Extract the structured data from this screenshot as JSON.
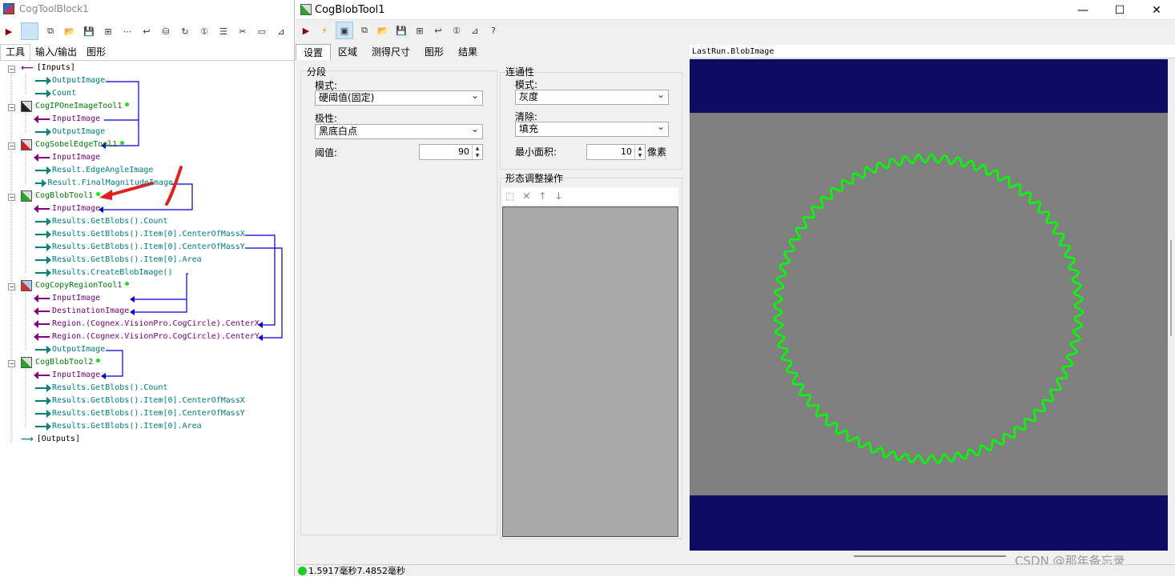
{
  "left_window": {
    "title": "CogToolBlock1",
    "tabs": [
      "工具",
      "输入/输出",
      "图形"
    ],
    "tree": [
      {
        "text": "[Inputs]",
        "kind": "group"
      },
      {
        "text": "OutputImage",
        "kind": "out"
      },
      {
        "text": "Count",
        "kind": "out"
      },
      {
        "text": "CogIPOneImageTool1",
        "kind": "tool"
      },
      {
        "text": "InputImage",
        "kind": "in"
      },
      {
        "text": "OutputImage",
        "kind": "out"
      },
      {
        "text": "CogSobelEdgeTool1",
        "kind": "tool"
      },
      {
        "text": "InputImage",
        "kind": "in"
      },
      {
        "text": "Result.EdgeAngleImage",
        "kind": "out"
      },
      {
        "text": "Result.FinalMagnitudeImage",
        "kind": "out"
      },
      {
        "text": "CogBlobTool1",
        "kind": "tool"
      },
      {
        "text": "InputImage",
        "kind": "in"
      },
      {
        "text": "Results.GetBlobs().Count",
        "kind": "out"
      },
      {
        "text": "Results.GetBlobs().Item[0].CenterOfMassX",
        "kind": "out"
      },
      {
        "text": "Results.GetBlobs().Item[0].CenterOfMassY",
        "kind": "out"
      },
      {
        "text": "Results.GetBlobs().Item[0].Area",
        "kind": "out"
      },
      {
        "text": "Results.CreateBlobImage()",
        "kind": "out"
      },
      {
        "text": "CogCopyRegionTool1",
        "kind": "tool"
      },
      {
        "text": "InputImage",
        "kind": "in"
      },
      {
        "text": "DestinationImage",
        "kind": "in"
      },
      {
        "text": "Region.(Cognex.VisionPro.CogCircle).CenterX",
        "kind": "in"
      },
      {
        "text": "Region.(Cognex.VisionPro.CogCircle).CenterY",
        "kind": "in"
      },
      {
        "text": "OutputImage",
        "kind": "out"
      },
      {
        "text": "CogBlobTool2",
        "kind": "tool"
      },
      {
        "text": "InputImage",
        "kind": "in"
      },
      {
        "text": "Results.GetBlobs().Count",
        "kind": "out"
      },
      {
        "text": "Results.GetBlobs().Item[0].CenterOfMassX",
        "kind": "out"
      },
      {
        "text": "Results.GetBlobs().Item[0].CenterOfMassY",
        "kind": "out"
      },
      {
        "text": "Results.GetBlobs().Item[0].Area",
        "kind": "out"
      },
      {
        "text": "[Outputs]",
        "kind": "group"
      }
    ]
  },
  "right_window": {
    "title": "CogBlobTool1",
    "tabs": [
      "设置",
      "区域",
      "测得尺寸",
      "图形",
      "结果"
    ],
    "segment": {
      "title": "分段",
      "mode_label": "模式:",
      "mode_value": "硬阈值(固定)",
      "polarity_label": "极性:",
      "polarity_value": "黑底白点",
      "threshold_label": "阈值:",
      "threshold_value": "90"
    },
    "connectivity": {
      "title": "连通性",
      "mode_label": "模式:",
      "mode_value": "灰度",
      "clean_label": "清除:",
      "clean_value": "填充",
      "min_area_label": "最小面积:",
      "min_area_value": "10",
      "min_area_unit": "像素"
    },
    "morphology": {
      "title": "形态调整操作"
    },
    "image_header": "LastRun.BlobImage",
    "status_text": "1.5917毫秒7.4852毫秒",
    "watermark": "CSDN @那年备忘录"
  },
  "colors": {
    "tree_out": "#008080",
    "tree_in": "#800080",
    "tool_name": "#008000",
    "link_line": "#0000cc",
    "image_bg_dark": "#0c0c64",
    "image_gray": "#808080",
    "blob_outline": "#00ff00"
  }
}
